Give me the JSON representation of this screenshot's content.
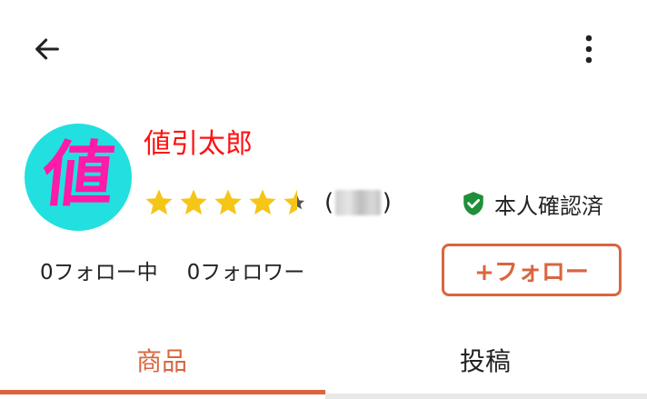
{
  "header": {
    "back_icon": "arrow-left-icon",
    "more_icon": "more-vertical-icon"
  },
  "profile": {
    "avatar_text": "値",
    "avatar_bg": "#22e0e0",
    "avatar_fg": "#ff1aa8",
    "name": "値引太郎",
    "name_color": "#ff1111",
    "rating": 4.5,
    "rating_max": 5,
    "review_open": "(",
    "review_count_hidden": "■■",
    "review_close": ")",
    "star_color": "#f5c518",
    "verified_label": "本人確認済",
    "verified_icon": "shield-check-icon",
    "verified_color": "#1f8f3a",
    "following": "0フォロー中",
    "followers": "0フォロワー",
    "follow_button": "+フォロー",
    "accent": "#d9653f"
  },
  "tabs": [
    {
      "label": "商品",
      "active": true
    },
    {
      "label": "投稿",
      "active": false
    }
  ]
}
